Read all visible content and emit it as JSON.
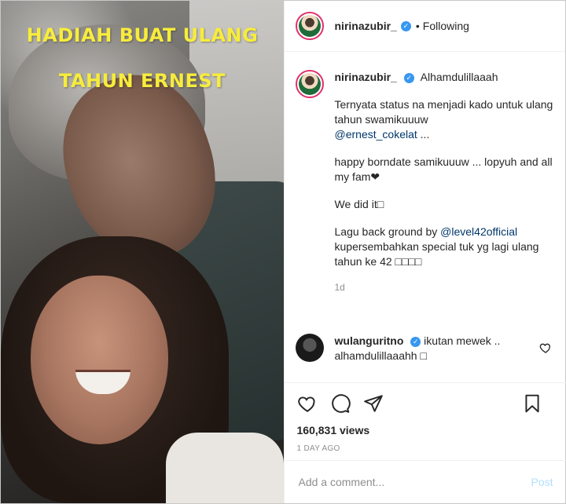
{
  "media": {
    "overlay_line1": "HADIAH BUAT ULANG",
    "overlay_line2": "TAHUN ERNEST"
  },
  "header": {
    "username": "nirinazubir_",
    "verified": true,
    "follow_status": "Following"
  },
  "caption": {
    "username": "nirinazubir_",
    "first_line": "Alhamdulillaaah",
    "para1_text": "Ternyata status na menjadi kado untuk ulang tahun swamikuuuw",
    "para1_mention": "@ernest_cokelat",
    "para1_tail": " ...",
    "para2": "happy borndate samikuuuw ... lopyuh and all my fam❤",
    "para3": "We did it□",
    "para4_lead": "Lagu back ground by ",
    "para4_mention": "@level42official",
    "para4_tail": " kupersembahkan special tuk yg lagi ulang tahun ke 42 □□□□",
    "time_ago": "1d"
  },
  "comment": {
    "username": "wulanguritno",
    "verified": true,
    "text": "ikutan mewek .. alhamdulillaaahh □"
  },
  "stats": {
    "views": "160,831 views",
    "date": "1 DAY AGO"
  },
  "add_comment": {
    "placeholder": "Add a comment...",
    "post_label": "Post"
  },
  "colors": {
    "overlay_text": "#f7ec3c",
    "link": "#00376b",
    "verified": "#3897f0",
    "post_disabled": "#b2dffc",
    "muted": "#8e8e8e"
  }
}
